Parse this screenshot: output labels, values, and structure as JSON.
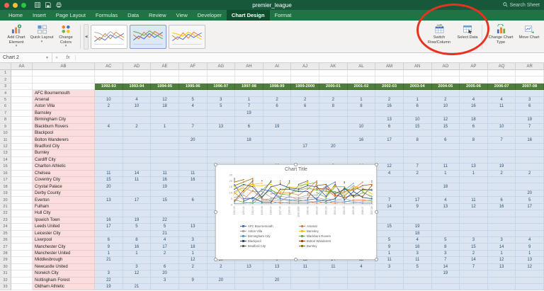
{
  "titlebar": {
    "title": "premier_league",
    "search": "Search Sheet"
  },
  "ribbon": {
    "tabs": [
      "Home",
      "Insert",
      "Page Layout",
      "Formulas",
      "Data",
      "Review",
      "View",
      "Developer",
      "Chart Design",
      "Format"
    ],
    "active_tab": "Chart Design",
    "buttons": {
      "add_chart_element": "Add Chart Element",
      "quick_layout": "Quick Layout",
      "change_colors": "Change Colors",
      "switch_row_column": "Switch Row/Column",
      "select_data": "Select Data",
      "change_chart_type": "Change Chart Type",
      "move_chart": "Move Chart"
    }
  },
  "formula_bar": {
    "name_box": "Chart 2",
    "fx_label": "fx"
  },
  "grid": {
    "visible_rows": 33,
    "columns": [
      "AA",
      "AB",
      "AC",
      "AD",
      "AE",
      "AF",
      "AG",
      "AH",
      "AI",
      "AJ",
      "AK",
      "AL",
      "AM",
      "AN",
      "AO",
      "AP",
      "AQ",
      "AR"
    ],
    "team_start_row": 4
  },
  "chart_data": {
    "type": "line",
    "title": "Chart Title",
    "xlabel": "",
    "ylabel": "",
    "ylim": [
      0,
      25
    ],
    "yticks": [
      0,
      5,
      10,
      15,
      20,
      25
    ],
    "grid": true,
    "legend_position": "bottom",
    "legend_entries": 10,
    "colors": [
      "#4472C4",
      "#ED7D31",
      "#A5A5A5",
      "#FFC000",
      "#5B9BD5",
      "#70AD47",
      "#264478",
      "#9E480E",
      "#636363",
      "#997300"
    ],
    "x": [
      "1992-93",
      "1993-94",
      "1994-95",
      "1995-96",
      "1996-97",
      "1997-98",
      "1998-99",
      "1999-2000",
      "2000-01",
      "2001-02",
      "2002-03",
      "2003-04",
      "2004-05",
      "2005-06",
      "2006-07",
      "2007-08"
    ],
    "series": [
      {
        "name": "AFC Bournemouth",
        "values": [
          null,
          null,
          null,
          null,
          null,
          null,
          null,
          null,
          null,
          null,
          null,
          null,
          null,
          null,
          null,
          null
        ]
      },
      {
        "name": "Arsenal",
        "values": [
          10,
          4,
          12,
          5,
          3,
          1,
          2,
          2,
          2,
          1,
          2,
          1,
          2,
          4,
          4,
          3
        ]
      },
      {
        "name": "Aston Villa",
        "values": [
          2,
          10,
          18,
          4,
          5,
          7,
          6,
          6,
          8,
          8,
          16,
          6,
          10,
          16,
          11,
          6
        ]
      },
      {
        "name": "Barnsley",
        "values": [
          null,
          null,
          null,
          null,
          null,
          19,
          null,
          null,
          null,
          null,
          null,
          null,
          null,
          null,
          null,
          null
        ]
      },
      {
        "name": "Birmingham City",
        "values": [
          null,
          null,
          null,
          null,
          null,
          null,
          null,
          null,
          null,
          null,
          13,
          10,
          12,
          18,
          null,
          19
        ]
      },
      {
        "name": "Blackburn Rovers",
        "values": [
          4,
          2,
          1,
          7,
          13,
          6,
          19,
          null,
          null,
          10,
          6,
          15,
          15,
          6,
          10,
          7
        ]
      },
      {
        "name": "Blackpool",
        "values": [
          null,
          null,
          null,
          null,
          null,
          null,
          null,
          null,
          null,
          null,
          null,
          null,
          null,
          null,
          null,
          null
        ]
      },
      {
        "name": "Bolton Wanderers",
        "values": [
          null,
          null,
          null,
          20,
          null,
          18,
          null,
          null,
          null,
          16,
          17,
          8,
          6,
          8,
          7,
          16
        ]
      },
      {
        "name": "Bradford City",
        "values": [
          null,
          null,
          null,
          null,
          null,
          null,
          null,
          17,
          20,
          null,
          null,
          null,
          null,
          null,
          null,
          null
        ]
      },
      {
        "name": "Burnley",
        "values": [
          null,
          null,
          null,
          null,
          null,
          null,
          null,
          null,
          null,
          null,
          null,
          null,
          null,
          null,
          null,
          null
        ]
      },
      {
        "name": "Cardiff City",
        "values": [
          null,
          null,
          null,
          null,
          null,
          null,
          null,
          null,
          null,
          null,
          null,
          null,
          null,
          null,
          null,
          null
        ]
      },
      {
        "name": "Charlton Athletic",
        "values": [
          null,
          null,
          null,
          null,
          null,
          null,
          18,
          null,
          9,
          14,
          12,
          7,
          11,
          13,
          19,
          null
        ]
      },
      {
        "name": "Chelsea",
        "values": [
          11,
          14,
          11,
          11,
          6,
          4,
          3,
          5,
          6,
          6,
          4,
          2,
          1,
          1,
          2,
          2
        ]
      },
      {
        "name": "Coventry City",
        "values": [
          15,
          11,
          16,
          16,
          17,
          11,
          15,
          14,
          19,
          null,
          null,
          null,
          null,
          null,
          null,
          null
        ]
      },
      {
        "name": "Crystal Palace",
        "values": [
          20,
          null,
          19,
          null,
          null,
          20,
          null,
          null,
          null,
          null,
          null,
          null,
          18,
          null,
          null,
          null
        ]
      },
      {
        "name": "Derby County",
        "values": [
          null,
          null,
          null,
          null,
          12,
          9,
          8,
          16,
          17,
          19,
          null,
          null,
          null,
          null,
          null,
          20
        ]
      },
      {
        "name": "Everton",
        "values": [
          13,
          17,
          15,
          6,
          15,
          17,
          14,
          13,
          16,
          15,
          7,
          17,
          4,
          11,
          6,
          5
        ]
      },
      {
        "name": "Fulham",
        "values": [
          null,
          null,
          null,
          null,
          null,
          null,
          null,
          null,
          null,
          13,
          14,
          9,
          13,
          12,
          16,
          17
        ]
      },
      {
        "name": "Hull City",
        "values": [
          null,
          null,
          null,
          null,
          null,
          null,
          null,
          null,
          null,
          null,
          null,
          null,
          null,
          null,
          null,
          null
        ]
      },
      {
        "name": "Ipswich Town",
        "values": [
          16,
          19,
          22,
          null,
          null,
          null,
          null,
          null,
          5,
          18,
          null,
          null,
          null,
          null,
          null,
          null
        ]
      },
      {
        "name": "Leeds United",
        "values": [
          17,
          5,
          5,
          13,
          11,
          5,
          4,
          3,
          4,
          5,
          15,
          19,
          null,
          null,
          null,
          null
        ]
      },
      {
        "name": "Leicester City",
        "values": [
          null,
          null,
          21,
          null,
          9,
          10,
          10,
          8,
          13,
          20,
          null,
          18,
          null,
          null,
          null,
          null
        ]
      },
      {
        "name": "Liverpool",
        "values": [
          6,
          8,
          4,
          3,
          4,
          3,
          7,
          4,
          3,
          2,
          5,
          4,
          5,
          3,
          3,
          4
        ]
      },
      {
        "name": "Manchester City",
        "values": [
          9,
          16,
          17,
          18,
          null,
          null,
          null,
          null,
          18,
          null,
          9,
          16,
          8,
          15,
          14,
          9
        ]
      },
      {
        "name": "Manchester United",
        "values": [
          1,
          1,
          2,
          1,
          1,
          2,
          1,
          1,
          1,
          3,
          1,
          3,
          3,
          2,
          1,
          1
        ]
      },
      {
        "name": "Middlesbrough",
        "values": [
          21,
          null,
          null,
          12,
          19,
          null,
          9,
          12,
          14,
          12,
          11,
          11,
          7,
          14,
          12,
          13
        ]
      },
      {
        "name": "Newcastle United",
        "values": [
          null,
          3,
          6,
          2,
          2,
          13,
          13,
          11,
          11,
          4,
          3,
          5,
          14,
          7,
          13,
          12
        ]
      },
      {
        "name": "Norwich City",
        "values": [
          3,
          12,
          20,
          null,
          null,
          null,
          null,
          null,
          null,
          null,
          null,
          null,
          19,
          null,
          null,
          null
        ]
      },
      {
        "name": "Nottingham Forest",
        "values": [
          22,
          null,
          3,
          9,
          20,
          null,
          20,
          null,
          null,
          null,
          null,
          null,
          null,
          null,
          null,
          null
        ]
      },
      {
        "name": "Oldham Athletic",
        "values": [
          19,
          21,
          null,
          null,
          null,
          null,
          null,
          null,
          null,
          null,
          null,
          null,
          null,
          null,
          null,
          null
        ]
      }
    ]
  },
  "annotation": {
    "shape": "ellipse",
    "color": "#e83220",
    "target": "switch-row-column-button"
  }
}
